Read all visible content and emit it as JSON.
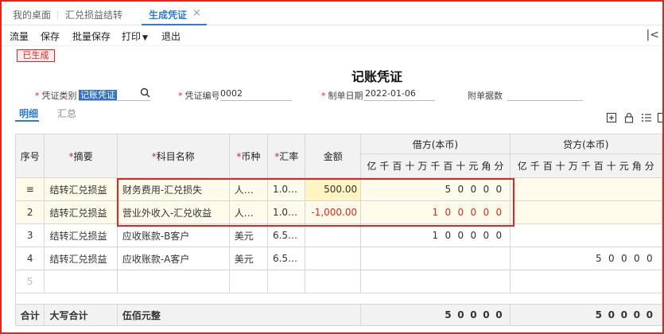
{
  "tabs": {
    "desktop": "我的桌面",
    "exchange": "汇兑损益结转",
    "voucher": "生成凭证",
    "close": "×"
  },
  "toolbar": {
    "flow": "流量",
    "save": "保存",
    "batch_save": "批量保存",
    "print": "打印",
    "exit": "退出",
    "collapse": "|<"
  },
  "badge": "已生成",
  "voucher_title": "记账凭证",
  "fields": {
    "type_label": "凭证类别",
    "type_value": "记账凭证",
    "number_label": "凭证编号",
    "number_value": "0002",
    "date_label": "制单日期",
    "date_value": "2022-01-06",
    "attach_label": "附单据数"
  },
  "subtabs": {
    "detail": "明细",
    "summary": "汇总"
  },
  "table": {
    "headers": {
      "no": "序号",
      "summary": "摘要",
      "account": "科目名称",
      "currency": "币种",
      "rate": "汇率",
      "amount": "金额",
      "debit": "借方(本币)",
      "credit": "贷方(本币)"
    },
    "units": [
      "亿",
      "千",
      "百",
      "十",
      "万",
      "千",
      "百",
      "十",
      "元",
      "角",
      "分"
    ],
    "rows": [
      {
        "no": "",
        "summary": "结转汇兑损益",
        "account": "财务费用-汇兑损失",
        "currency": "人…",
        "rate": "1.0…",
        "amount": "500.00",
        "debit": [
          "",
          "",
          "",
          "",
          "",
          "",
          "5",
          "0",
          "0",
          "0",
          "0"
        ],
        "credit": [
          "",
          "",
          "",
          "",
          "",
          "",
          "",
          "",
          "",
          "",
          ""
        ]
      },
      {
        "no": "2",
        "summary": "结转汇兑损益",
        "account": "营业外收入-汇兑收益",
        "currency": "人…",
        "rate": "1.0…",
        "amount": "-1,000.00",
        "debit": [
          "",
          "",
          "",
          "",
          "",
          "1",
          "0",
          "0",
          "0",
          "0",
          "0"
        ],
        "credit": [
          "",
          "",
          "",
          "",
          "",
          "",
          "",
          "",
          "",
          "",
          ""
        ]
      },
      {
        "no": "3",
        "summary": "结转汇兑损益",
        "account": "应收账款-B客户",
        "currency": "美元",
        "rate": "6.5…",
        "amount": "",
        "debit": [
          "",
          "",
          "",
          "",
          "",
          "1",
          "0",
          "0",
          "0",
          "0",
          "0"
        ],
        "credit": [
          "",
          "",
          "",
          "",
          "",
          "",
          "",
          "",
          "",
          "",
          ""
        ]
      },
      {
        "no": "4",
        "summary": "结转汇兑损益",
        "account": "应收账款-A客户",
        "currency": "美元",
        "rate": "6.5…",
        "amount": "",
        "debit": [
          "",
          "",
          "",
          "",
          "",
          "",
          "",
          "",
          "",
          "",
          ""
        ],
        "credit": [
          "",
          "",
          "",
          "",
          "",
          "",
          "5",
          "0",
          "0",
          "0",
          "0"
        ]
      },
      {
        "no": "5",
        "summary": "",
        "account": "",
        "currency": "",
        "rate": "",
        "amount": "",
        "debit": [
          "",
          "",
          "",
          "",
          "",
          "",
          "",
          "",
          "",
          "",
          ""
        ],
        "credit": [
          "",
          "",
          "",
          "",
          "",
          "",
          "",
          "",
          "",
          "",
          ""
        ]
      }
    ],
    "total": {
      "label": "合计",
      "caps_label": "大写合计",
      "caps_value": "伍佰元整",
      "debit": [
        "",
        "",
        "",
        "",
        "",
        "",
        "5",
        "0",
        "0",
        "0",
        "0"
      ],
      "credit": [
        "",
        "",
        "",
        "",
        "",
        "",
        "5",
        "0",
        "0",
        "0",
        "0"
      ]
    }
  },
  "colors": {
    "accent": "#2d7bd6",
    "danger": "#e0261f",
    "highlight_row": "#fffbea"
  }
}
